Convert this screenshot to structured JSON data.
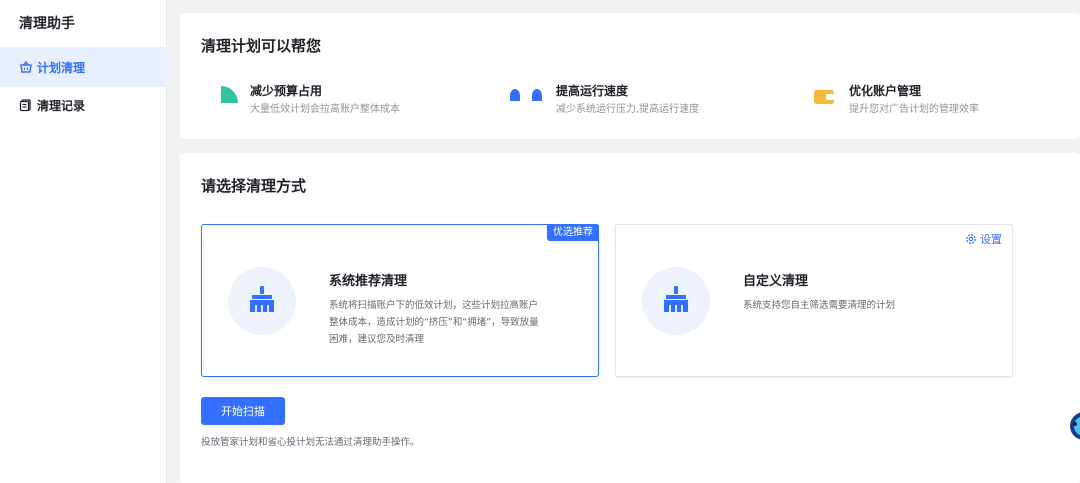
{
  "sidebar": {
    "title": "清理助手",
    "items": [
      {
        "label": "计划清理",
        "icon": "basket-icon",
        "active": true
      },
      {
        "label": "清理记录",
        "icon": "document-icon",
        "active": false
      }
    ]
  },
  "benefits_card": {
    "title": "清理计划可以帮您",
    "items": [
      {
        "title": "减少预算占用",
        "desc": "大量低效计划会拉高账户整体成本",
        "icon": "budget-icon",
        "color": "#2fc5a0"
      },
      {
        "title": "提高运行速度",
        "desc": "减少系统运行压力,提高运行速度",
        "icon": "speed-icon",
        "color": "#3370ff"
      },
      {
        "title": "优化账户管理",
        "desc": "提升您对广告计划的管理效率",
        "icon": "wallet-icon",
        "color": "#f5b93a"
      }
    ]
  },
  "method_card": {
    "title": "请选择清理方式",
    "options": [
      {
        "title": "系统推荐清理",
        "desc": "系统将扫描账户下的低效计划，这些计划拉高账户整体成本，造成计划的“挤压”和“拥堵”，导致放量困难，建议您及时清理",
        "badge": "优选推荐",
        "selected": true,
        "icon": "broom-icon"
      },
      {
        "title": "自定义清理",
        "desc": "系统支持您自主筛选需要清理的计划",
        "settings_label": "设置",
        "selected": false,
        "icon": "broom-icon"
      }
    ],
    "start_button": "开始扫描",
    "note": "投放管家计划和省心投计划无法通过清理助手操作。"
  },
  "colors": {
    "primary": "#3370ff",
    "active_bg": "#e8effe",
    "page_bg": "#f2f3f5"
  }
}
